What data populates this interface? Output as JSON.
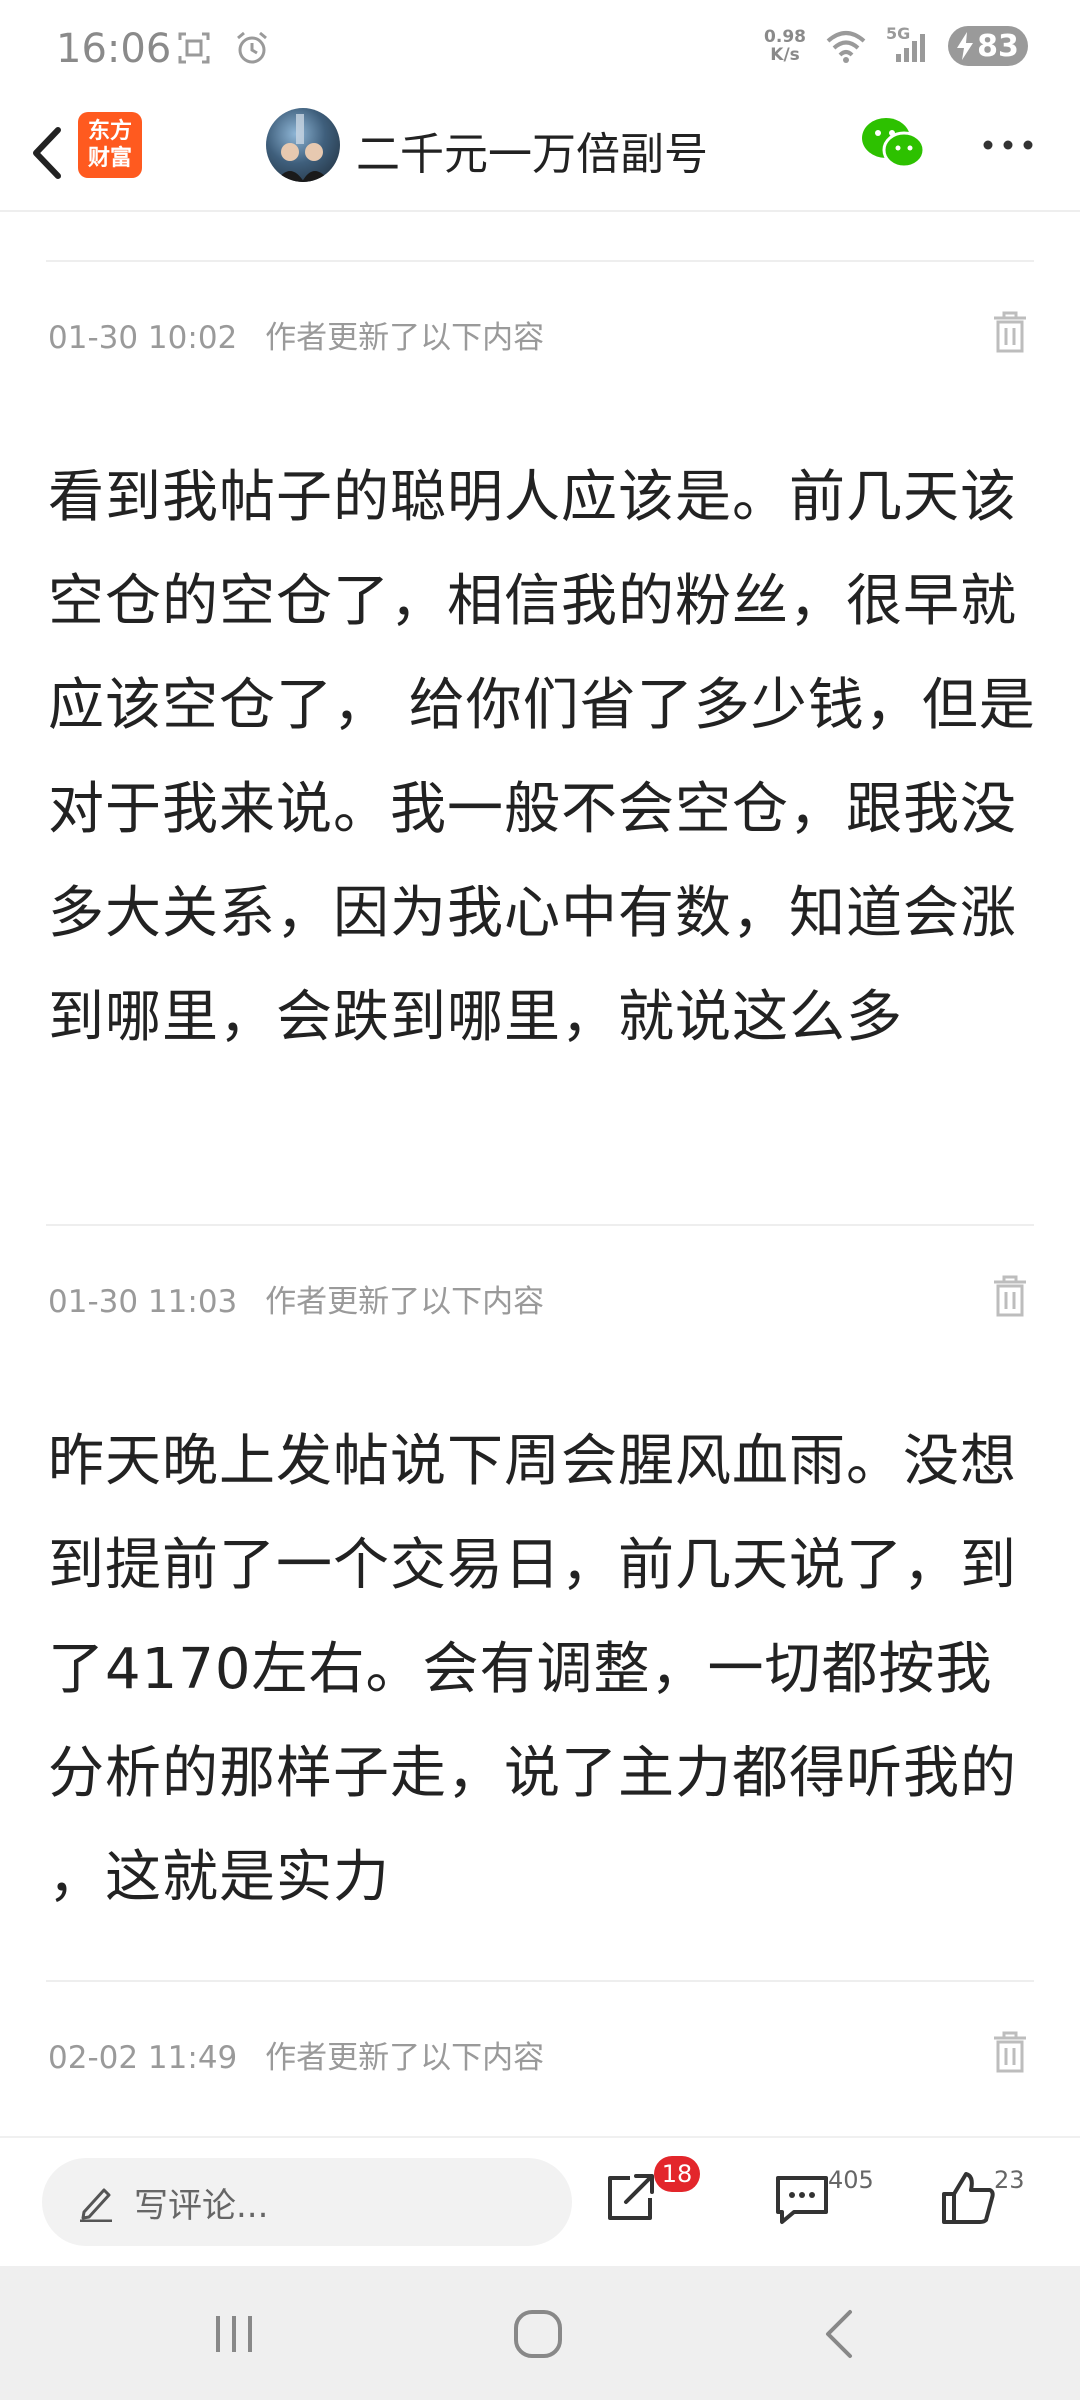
{
  "status_bar": {
    "time": "16:06",
    "net_speed_value": "0.98",
    "net_speed_unit": "K/s",
    "network": "5G",
    "battery": "83"
  },
  "header": {
    "app_logo_line1": "东方",
    "app_logo_line2": "财富",
    "author_name": "二千元一万倍副号"
  },
  "updates": [
    {
      "time": "01-30 10:02",
      "label": "作者更新了以下内容",
      "text": "看到我帖子的聪明人应该是。前几天该空仓的空仓了，相信我的粉丝，很早就应该空仓了， 给你们省了多少钱，但是对于我来说。我一般不会空仓，跟我没多大关系，因为我心中有数，知道会涨到哪里，会跌到哪里，就说这么多"
    },
    {
      "time": "01-30 11:03",
      "label": "作者更新了以下内容",
      "text": "昨天晚上发帖说下周会腥风血雨。没想到提前了一个交易日，前几天说了，到了4170左右。会有调整，一切都按我分析的那样子走，说了主力都得听我的 ，这就是实力"
    },
    {
      "time": "02-02 11:49",
      "label": "作者更新了以下内容"
    }
  ],
  "action_bar": {
    "comment_placeholder": "写评论...",
    "share_badge": "18",
    "comment_count": "405",
    "like_count": "23"
  },
  "colors": {
    "accent_orange": "#ff5a1f",
    "badge_red": "#e3262b",
    "wechat_green": "#2dc100"
  }
}
